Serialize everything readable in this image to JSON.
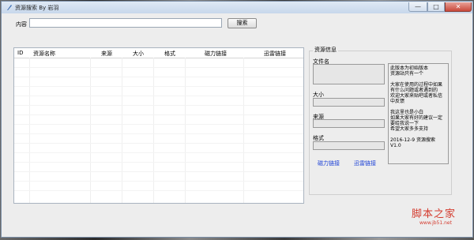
{
  "window": {
    "title": "资源搜索 By 岩羽"
  },
  "search": {
    "label": "内容",
    "value": "",
    "button_label": "搜索"
  },
  "table": {
    "headers": [
      "ID",
      "资源名称",
      "来源",
      "大小",
      "格式",
      "磁力链接",
      "迅雷链接"
    ]
  },
  "info": {
    "group_title": "资源信息",
    "filename_label": "文件名",
    "size_label": "大小",
    "source_label": "来源",
    "format_label": "格式",
    "magnet_link_label": "磁力链接",
    "thunder_link_label": "迅雷链接",
    "notes": "此版本为初始版本\n资源站只有一个\n\n大家在使用的过程中如果有什么问题或者遇到的\n欢迎大家来贴吧或者私信中反馈\n\n我这里也是小白\n如果大家有好的建议一定要给我说一下\n希望大家多多支持\n\n2016-12-9  资源搜索 V1.0"
  },
  "watermark": {
    "brand": "脚本之家",
    "url": "www.jb51.net"
  },
  "colors": {
    "link": "#1a3fd6",
    "titlebar": "#c7d7eb",
    "close_button": "#c9483a",
    "watermark": "#d43b2e"
  }
}
